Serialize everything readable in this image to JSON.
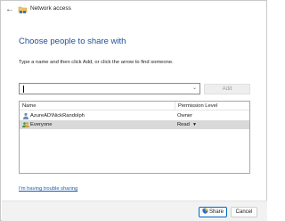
{
  "window": {
    "title": "Network access"
  },
  "main": {
    "heading": "Choose people to share with",
    "instruction": "Type a name and then click Add, or click the arrow to find someone.",
    "name_input": {
      "value": "",
      "placeholder": ""
    },
    "add_label": "Add"
  },
  "list": {
    "columns": [
      "Name",
      "Permission Level"
    ],
    "rows": [
      {
        "name": "AzureAD\\NickRandolph",
        "permission": "Owner",
        "icon": "user-icon"
      },
      {
        "name": "Everyone",
        "permission": "Read",
        "icon": "group-icon",
        "has_dropdown": true,
        "selected": true
      }
    ]
  },
  "trouble_link": "I'm having trouble sharing",
  "footer": {
    "share_label": "Share",
    "cancel_label": "Cancel"
  },
  "colors": {
    "heading": "#1f4e9c",
    "link": "#1a5fb4",
    "accent": "#0067c0",
    "selected_row": "#d9d9d9"
  }
}
